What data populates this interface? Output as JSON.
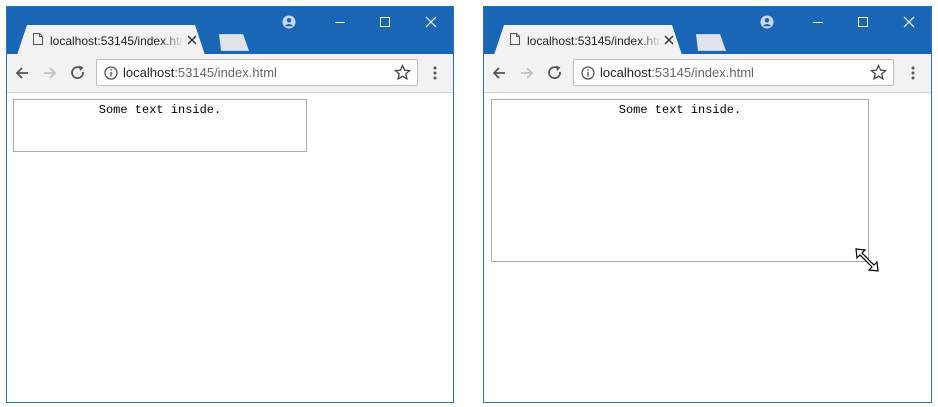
{
  "windows": [
    {
      "tab": {
        "title": "localhost:53145/index.html"
      },
      "address": {
        "host": "localhost",
        "path": ":53145/index.html"
      },
      "textarea": {
        "text": "Some text inside."
      }
    },
    {
      "tab": {
        "title": "localhost:53145/index.html"
      },
      "address": {
        "host": "localhost",
        "path": ":53145/index.html"
      },
      "textarea": {
        "text": "Some text inside."
      }
    }
  ],
  "colors": {
    "titlebar": "#1a66b6",
    "toolbar": "#f2f2f2",
    "border": "#2b73b8"
  },
  "icons": [
    "page-icon",
    "close-icon",
    "user-icon",
    "minimize-icon",
    "maximize-icon",
    "window-close-icon",
    "back-arrow-icon",
    "forward-arrow-icon",
    "reload-icon",
    "info-icon",
    "star-icon",
    "menu-icon",
    "resize-cursor-icon"
  ]
}
